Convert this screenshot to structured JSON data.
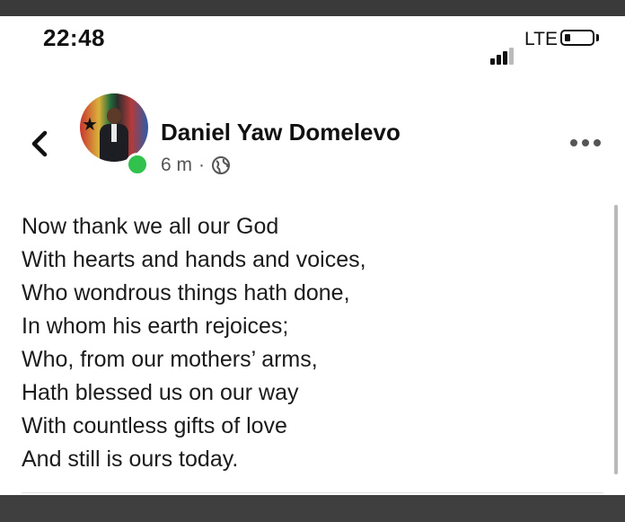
{
  "status_bar": {
    "time": "22:48",
    "network": "LTE",
    "icons": [
      "signal-icon",
      "battery-icon"
    ]
  },
  "header": {
    "back_icon": "chevron-left-icon",
    "author_name": "Daniel Yaw Domelevo",
    "timestamp": "6 m",
    "separator": "·",
    "audience_icon": "globe-icon",
    "online": true,
    "more_icon": "more-horizontal-icon"
  },
  "post": {
    "lines": [
      "Now thank we all our God",
      "With hearts and hands and voices,",
      "Who wondrous things hath done,",
      "In whom his earth rejoices;",
      "Who, from our mothers’ arms,",
      "Hath blessed us on our way",
      "With countless gifts of love",
      "And still is ours today."
    ]
  },
  "colors": {
    "online": "#31c24d",
    "text": "#1b1b1b",
    "frame": "#3a3a3a"
  }
}
